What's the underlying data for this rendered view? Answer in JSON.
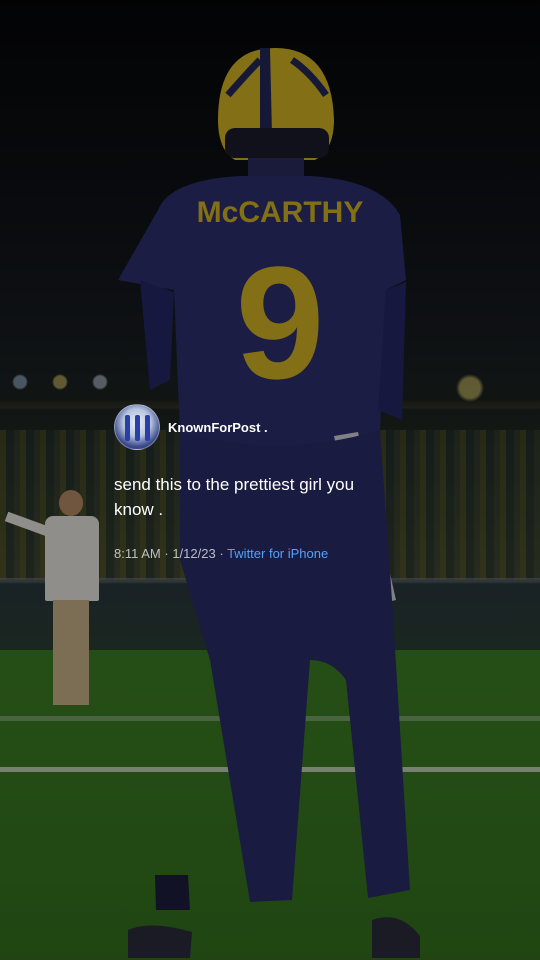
{
  "tweet": {
    "author_handle": "KnownForPost .",
    "text": "send this to the prettiest girl you know .",
    "time": "8:11 AM",
    "date": "1/12/23",
    "separator": "·",
    "source": "Twitter for iPhone"
  },
  "photo": {
    "jersey_name": "McCARTHY",
    "jersey_number": "9",
    "colors": {
      "jersey": "#2e2f6e",
      "maize": "#d4b322",
      "field": "#3a7a22",
      "link": "#4fa3ff"
    }
  }
}
